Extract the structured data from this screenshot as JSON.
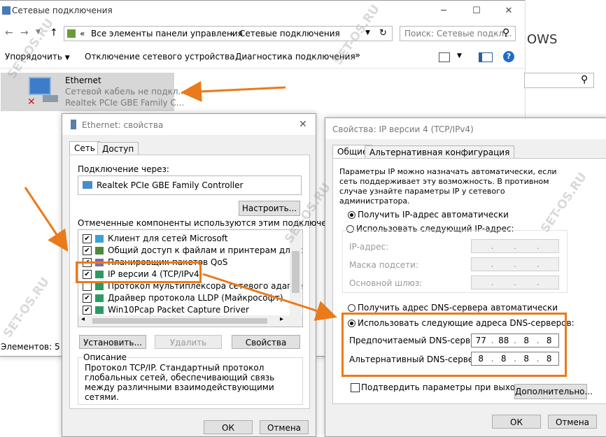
{
  "background_window": {
    "title": "Сетевые подключения",
    "address": {
      "chevron": "«",
      "crumbs": [
        "Все элементы панели управления",
        "Сетевые подключения"
      ],
      "search_placeholder": "Поиск: Сетевые подкл..."
    },
    "toolbar": {
      "organize": "Упорядочить",
      "disable": "Отключение сетевого устройства",
      "diagnose": "Диагностика подключения",
      "more": "»"
    },
    "adapter": {
      "name": "Ethernet",
      "status": "Сетевой кабель не подкл...",
      "device": "Realtek PCIe GBE Family C..."
    },
    "status_bar": "Элементов: 5",
    "right_edge_text": "OWS"
  },
  "eth_dialog": {
    "title": "Ethernet: свойства",
    "tabs": [
      "Сеть",
      "Доступ"
    ],
    "connect_using_label": "Подключение через:",
    "adapter_name": "Realtek PCIe GBE Family Controller",
    "configure_button": "Настроить...",
    "components_label": "Отмеченные компоненты используются этим подключением:",
    "components": [
      {
        "label": "Клиент для сетей Microsoft",
        "checked": true
      },
      {
        "label": "Общий доступ к файлам и принтерам для сетей Mi",
        "checked": true
      },
      {
        "label": "Планировщик пакетов QoS",
        "checked": true
      },
      {
        "label": "IP версии 4 (TCP/IPv4)",
        "checked": true
      },
      {
        "label": "Протокол мультиплексора сетевого адаптера (Mai",
        "checked": false
      },
      {
        "label": "Драйвер протокола LLDP (Майкрософт)",
        "checked": true
      },
      {
        "label": "Win10Pcap Packet Capture Driver",
        "checked": true
      }
    ],
    "install_button": "Установить...",
    "remove_button": "Удалить",
    "properties_button": "Свойства",
    "description_label": "Описание",
    "description_text": "Протокол TCP/IP. Стандартный протокол глобальных сетей, обеспечивающий связь между различными взаимодействующими сетями.",
    "ok_button": "ОК",
    "cancel_button": "Отмена"
  },
  "ipv4_dialog": {
    "title": "Свойства: IP версии 4 (TCP/IPv4)",
    "tabs": [
      "Общие",
      "Альтернативная конфигурация"
    ],
    "intro": "Параметры IP можно назначать автоматически, если сеть поддерживает эту возможность. В противном случае узнайте параметры IP у сетевого администратора.",
    "ip_auto": "Получить IP-адрес автоматически",
    "ip_manual": "Использовать следующий IP-адрес:",
    "ip_address_label": "IP-адрес:",
    "subnet_label": "Маска подсети:",
    "gateway_label": "Основной шлюз:",
    "dns_auto": "Получить адрес DNS-сервера автоматически",
    "dns_manual": "Использовать следующие адреса DNS-серверов:",
    "preferred_dns_label": "Предпочитаемый DNS-сервер:",
    "preferred_dns": [
      "77",
      "88",
      "8",
      "8"
    ],
    "alternate_dns_label": "Альтернативный DNS-сервер:",
    "alternate_dns": [
      "8",
      "8",
      "8",
      "8"
    ],
    "validate_label": "Подтвердить параметры при выходе",
    "advanced_button": "Дополнительно...",
    "ok_button": "ОК",
    "cancel_button": "Отмена"
  },
  "watermark": "SET-OS.RU",
  "colors": {
    "highlight": "#ea7a1a",
    "selection": "#cce4f7"
  }
}
